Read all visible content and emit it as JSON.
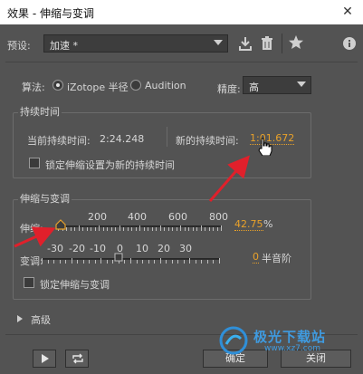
{
  "window": {
    "title": "效果 - 伸缩与变调",
    "close": "✕"
  },
  "preset": {
    "label": "预设:",
    "value": "加速 *"
  },
  "algorithm": {
    "label": "算法:",
    "options": [
      "iZotope 半径",
      "Audition"
    ],
    "selected": 0,
    "precision_label": "精度:",
    "precision_value": "高"
  },
  "duration": {
    "title": "持续时间",
    "current_label": "当前持续时间:",
    "current_value": "2:24.248",
    "new_label": "新的持续时间:",
    "new_value": "1:01.672",
    "lock_label": "锁定伸缩设置为新的持续时间"
  },
  "stretch_pitch": {
    "title": "伸缩与变调",
    "stretch_label": "伸缩:",
    "stretch_ticks": [
      "200",
      "400",
      "600",
      "800"
    ],
    "stretch_value": "42.75",
    "stretch_unit": "%",
    "pitch_label": "变调:",
    "pitch_ticks": [
      "-30",
      "-20",
      "-10",
      "0",
      "10",
      "20",
      "30"
    ],
    "pitch_value": "0",
    "pitch_unit": "半音阶",
    "lock_label": "锁定伸缩与变调"
  },
  "advanced": {
    "label": "高级"
  },
  "footer": {
    "ok": "确定",
    "close": "关闭"
  },
  "watermark": {
    "text": "极光下载站",
    "url": "www.xz7.com"
  },
  "colors": {
    "accent": "#e8a12a",
    "arrow": "#e0202b",
    "panel": "#535353"
  }
}
